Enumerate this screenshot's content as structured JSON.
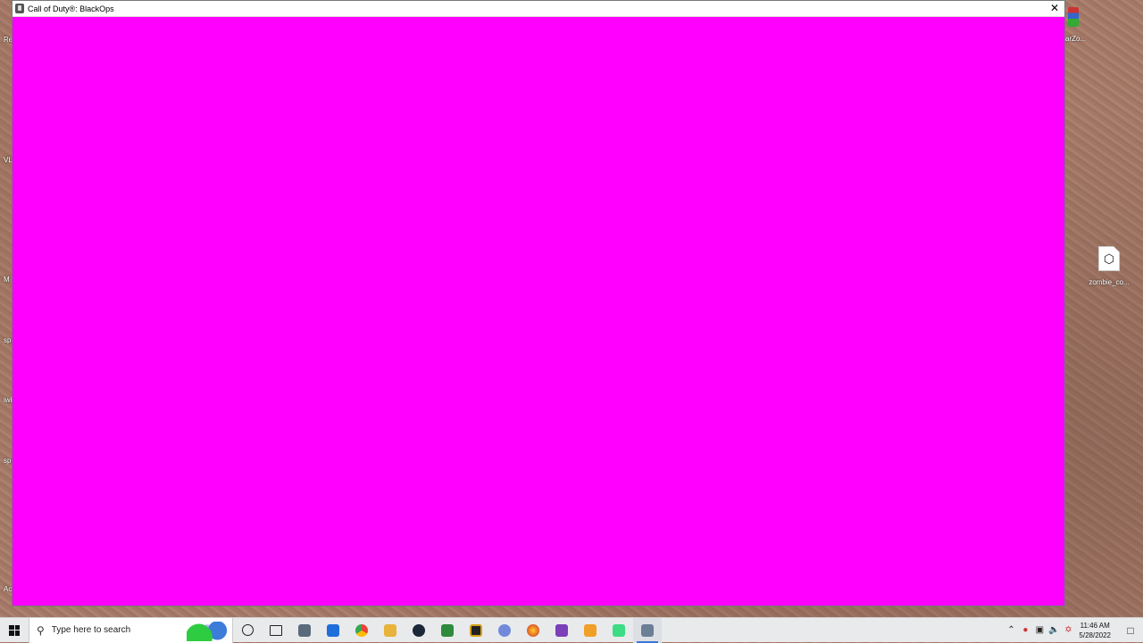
{
  "window": {
    "title": "Call of Duty®: BlackOps",
    "close_glyph": "✕",
    "content_color": "#ff00ff"
  },
  "desktop": {
    "left_labels": [
      "Re",
      "VL",
      "M",
      "spe",
      "iwi",
      "spe",
      "Ac"
    ],
    "top_right_label": "arZo...",
    "right_icon": {
      "icon": "box-icon",
      "glyph": "⬡",
      "label": "zombie_co..."
    }
  },
  "taskbar": {
    "search_placeholder": "Type here to search",
    "apps": [
      {
        "name": "microsoft-store",
        "color": "#5a6b7c"
      },
      {
        "name": "mail",
        "color": "#1e6fd9"
      },
      {
        "name": "chrome",
        "color": "#34a853"
      },
      {
        "name": "file-explorer",
        "color": "#e8b33a"
      },
      {
        "name": "steam",
        "color": "#1b2838"
      },
      {
        "name": "green-app",
        "color": "#2e8b3e"
      },
      {
        "name": "rockstar",
        "color": "#d4a017"
      },
      {
        "name": "discord",
        "color": "#7289da"
      },
      {
        "name": "firefox",
        "color": "#e56b1f"
      },
      {
        "name": "visual-studio",
        "color": "#7b3fb7"
      },
      {
        "name": "sublime-text",
        "color": "#f0a028"
      },
      {
        "name": "android-studio",
        "color": "#3ddc84"
      },
      {
        "name": "black-ops",
        "color": "#6b7f95",
        "active": true
      }
    ],
    "tray": {
      "time": "11:46 AM",
      "date": "5/28/2022"
    }
  }
}
